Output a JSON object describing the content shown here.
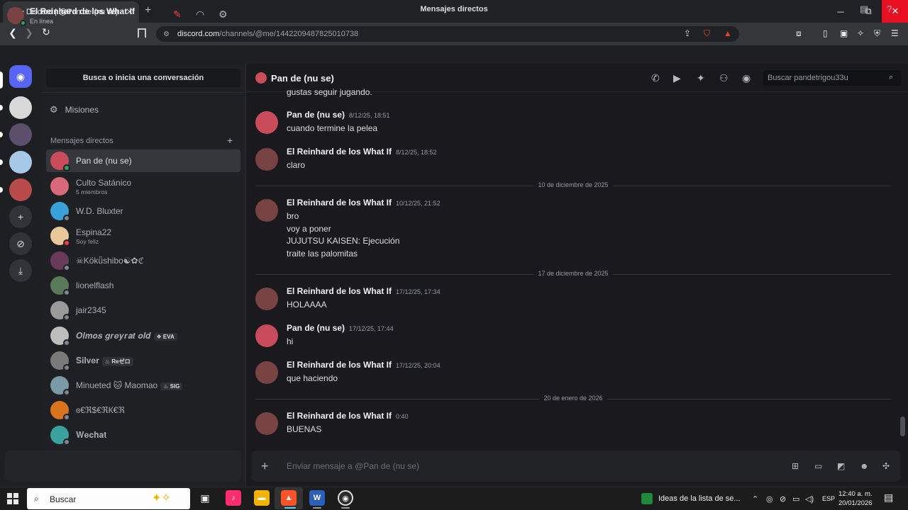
{
  "browser": {
    "tab_title": "• Discord | @Pan de (nu se)",
    "tab_close": "✕",
    "new_tab": "+",
    "url_host": "discord.com",
    "url_path": "/channels/@me/1442209487825010738",
    "win_min": "─",
    "win_max": "⧉",
    "win_close": "✕"
  },
  "discord_top": {
    "title": "Mensajes directos"
  },
  "sidebar": {
    "search_label": "Busca o inicia una conversación",
    "missions_label": "Misiones",
    "dm_header": "Mensajes directos",
    "dm_add": "+",
    "items": [
      {
        "name": "Pan de (nu se)",
        "sub": "",
        "badge": "",
        "status": "online",
        "avatar_color": "#c94c5a"
      },
      {
        "name": "Culto Satánico",
        "sub": "5 miembros",
        "badge": "",
        "status": "",
        "avatar_color": "#d66a7a"
      },
      {
        "name": "W.D. Bluxter",
        "sub": "",
        "badge": "",
        "status": "offline",
        "avatar_color": "#3aa0d8"
      },
      {
        "name": "Espina22",
        "sub": "Soy feliz",
        "badge": "",
        "status": "dnd",
        "avatar_color": "#e8c89a"
      },
      {
        "name": "☠Kökü̈shibo☯✿ℭ",
        "sub": "",
        "badge": "",
        "status": "offline",
        "avatar_color": "#6a3a5a"
      },
      {
        "name": "lionelflash",
        "sub": "",
        "badge": "",
        "status": "offline",
        "avatar_color": "#5a7a5a"
      },
      {
        "name": "jair2345",
        "sub": "",
        "badge": "",
        "status": "offline",
        "avatar_color": "#9a9a9a"
      },
      {
        "name": "𝑶𝒍𝒎𝒐𝒔 𝒈𝒓𝒆𝒚𝒓𝒂𝒕 𝒐𝒍𝒅",
        "sub": "",
        "badge": "❖ EVA",
        "status": "offline",
        "avatar_color": "#bdbdbd"
      },
      {
        "name": "𝐒𝐢𝐥𝐯𝐞𝐫",
        "sub": "",
        "badge": "♨ Reゼロ",
        "status": "offline",
        "avatar_color": "#7a7a7a"
      },
      {
        "name": "Minueted 🐱 Maomao",
        "sub": "",
        "badge": "♨ SIG",
        "status": "offline",
        "avatar_color": "#7a9aa8"
      },
      {
        "name": "ɞ€ℜ$€ℜК€ℜ",
        "sub": "",
        "badge": "",
        "status": "offline",
        "avatar_color": "#d8731e"
      },
      {
        "name": "𝐖𝐞𝐜𝐡𝐚𝐭",
        "sub": "",
        "badge": "",
        "status": "offline",
        "avatar_color": "#3aa0a0"
      }
    ]
  },
  "user_panel": {
    "name": "El Reinhard de los What If",
    "state": "En línea"
  },
  "chat": {
    "title": "Pan de (nu se)",
    "search_placeholder": "Buscar pandetrigou33u",
    "cut_line": "gustas seguir jugando.",
    "messages": [
      {
        "author": "Pan de (nu se)",
        "time": "8/12/25, 18:51",
        "lines": [
          "cuando termine la pelea"
        ],
        "avatar_color": "#c94c5a"
      },
      {
        "author": "El Reinhard de los What If",
        "time": "8/12/25, 18:52",
        "lines": [
          "claro"
        ],
        "avatar_color": "#7a4343"
      },
      {
        "author": "El Reinhard de los What If",
        "time": "10/12/25, 21:52",
        "lines": [
          "bro",
          "voy a poner",
          "JUJUTSU KAISEN: Ejecución",
          "traite las palomitas"
        ],
        "avatar_color": "#7a4343"
      },
      {
        "author": "El Reinhard de los What If",
        "time": "17/12/25, 17:34",
        "lines": [
          "HOLAAAA"
        ],
        "avatar_color": "#7a4343"
      },
      {
        "author": "Pan de (nu se)",
        "time": "17/12/25, 17:44",
        "lines": [
          "hi"
        ],
        "avatar_color": "#c94c5a"
      },
      {
        "author": "El Reinhard de los What If",
        "time": "17/12/25, 20:04",
        "lines": [
          "que haciendo"
        ],
        "avatar_color": "#7a4343"
      },
      {
        "author": "El Reinhard de los What If",
        "time": "0:40",
        "lines": [
          "BUENAS"
        ],
        "avatar_color": "#7a4343"
      }
    ],
    "day_separators": [
      "10 de diciembre de 2025",
      "17 de diciembre de 2025",
      "20 de enero de 2026"
    ],
    "composer_placeholder": "Enviar mensaje a @Pan de (nu se)"
  },
  "taskbar": {
    "search_label": "Buscar",
    "note_label": "Ideas de la lista de se...",
    "lang": "ESP",
    "time": "12:40 a. m.",
    "date": "20/01/2026"
  },
  "colors": {
    "accent": "#5865f2",
    "online": "#23a55a",
    "dnd": "#f23f43",
    "offline": "#80848e"
  }
}
